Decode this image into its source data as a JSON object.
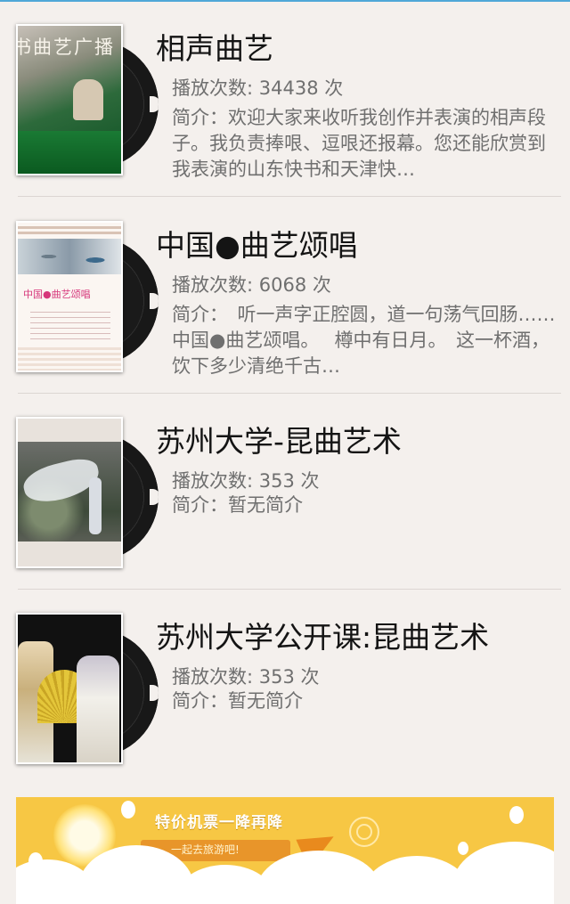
{
  "items": [
    {
      "title": "相声曲艺",
      "plays": "播放次数: 34438 次",
      "desc": "简介：欢迎大家来收听我创作并表演的相声段子。我负责捧哏、逗哏还报幕。您还能欣赏到我表演的山东快书和天津快…",
      "cover_text": "书曲艺广播"
    },
    {
      "title": "中国●曲艺颂唱",
      "plays": "播放次数: 6068 次",
      "desc": "简介：　听一声字正腔圆，道一句荡气回肠……　 中国●曲艺颂唱。　 樽中有日月。　这一杯酒，饮下多少清绝千古…",
      "cover_text": "中国●曲艺颂唱"
    },
    {
      "title": "苏州大学-昆曲艺术",
      "plays": "播放次数: 353 次",
      "desc": "简介：暂无简介"
    },
    {
      "title": "苏州大学公开课:昆曲艺术",
      "plays": "播放次数: 353 次",
      "desc": "简介：暂无简介"
    }
  ],
  "ad": {
    "headline": "特价机票一降再降",
    "tagline": "一起去旅游吧!"
  },
  "colors": {
    "background": "#f4f0ed",
    "title": "#141414",
    "meta": "#6f6f6f",
    "ad_bg": "#f7c744"
  }
}
